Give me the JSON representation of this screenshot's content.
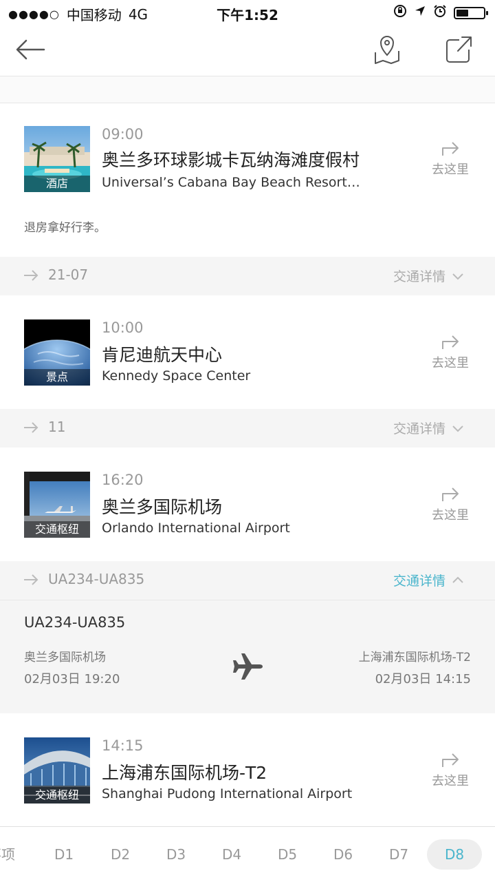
{
  "status_bar": {
    "signal": "●●●●○",
    "carrier": "中国移动",
    "network": "4G",
    "time": "下午1:52",
    "battery_level": 0.45
  },
  "nav": {
    "icons": [
      "back-arrow-icon",
      "map-pin-icon",
      "share-icon"
    ]
  },
  "items": [
    {
      "time": "09:00",
      "title": "奥兰多环球影城卡瓦纳海滩度假村",
      "subtitle": "Universal’s Cabana Bay Beach Resort…",
      "tag": "酒店",
      "goto": "去这里",
      "note": "退房拿好行李。"
    },
    {
      "time": "10:00",
      "title": "肯尼迪航天中心",
      "subtitle": "Kennedy Space Center",
      "tag": "景点",
      "goto": "去这里"
    },
    {
      "time": "16:20",
      "title": "奥兰多国际机场",
      "subtitle": "Orlando International Airport",
      "tag": "交通枢纽",
      "goto": "去这里"
    },
    {
      "time": "14:15",
      "title": "上海浦东国际机场-T2",
      "subtitle": "Shanghai Pudong International Airport",
      "tag": "交通枢纽",
      "goto": "去这里"
    }
  ],
  "transports": [
    {
      "code": "21-07",
      "detail": "交通详情",
      "expanded": false
    },
    {
      "code": "11",
      "detail": "交通详情",
      "expanded": false
    },
    {
      "code": "UA234-UA835",
      "detail": "交通详情",
      "expanded": true
    }
  ],
  "flight": {
    "number": "UA234-UA835",
    "from": "奥兰多国际机场",
    "from_time": "02月03日 19:20",
    "to": "上海浦东国际机场-T2",
    "to_time": "02月03日 14:15"
  },
  "tabs": [
    {
      "label": "事项"
    },
    {
      "label": "D1"
    },
    {
      "label": "D2"
    },
    {
      "label": "D3"
    },
    {
      "label": "D4"
    },
    {
      "label": "D5"
    },
    {
      "label": "D6"
    },
    {
      "label": "D7"
    },
    {
      "label": "D8",
      "active": true
    }
  ],
  "colors": {
    "accent": "#4ab5cc",
    "transport_bg": "#f5f5f5",
    "muted_text": "#999999"
  }
}
